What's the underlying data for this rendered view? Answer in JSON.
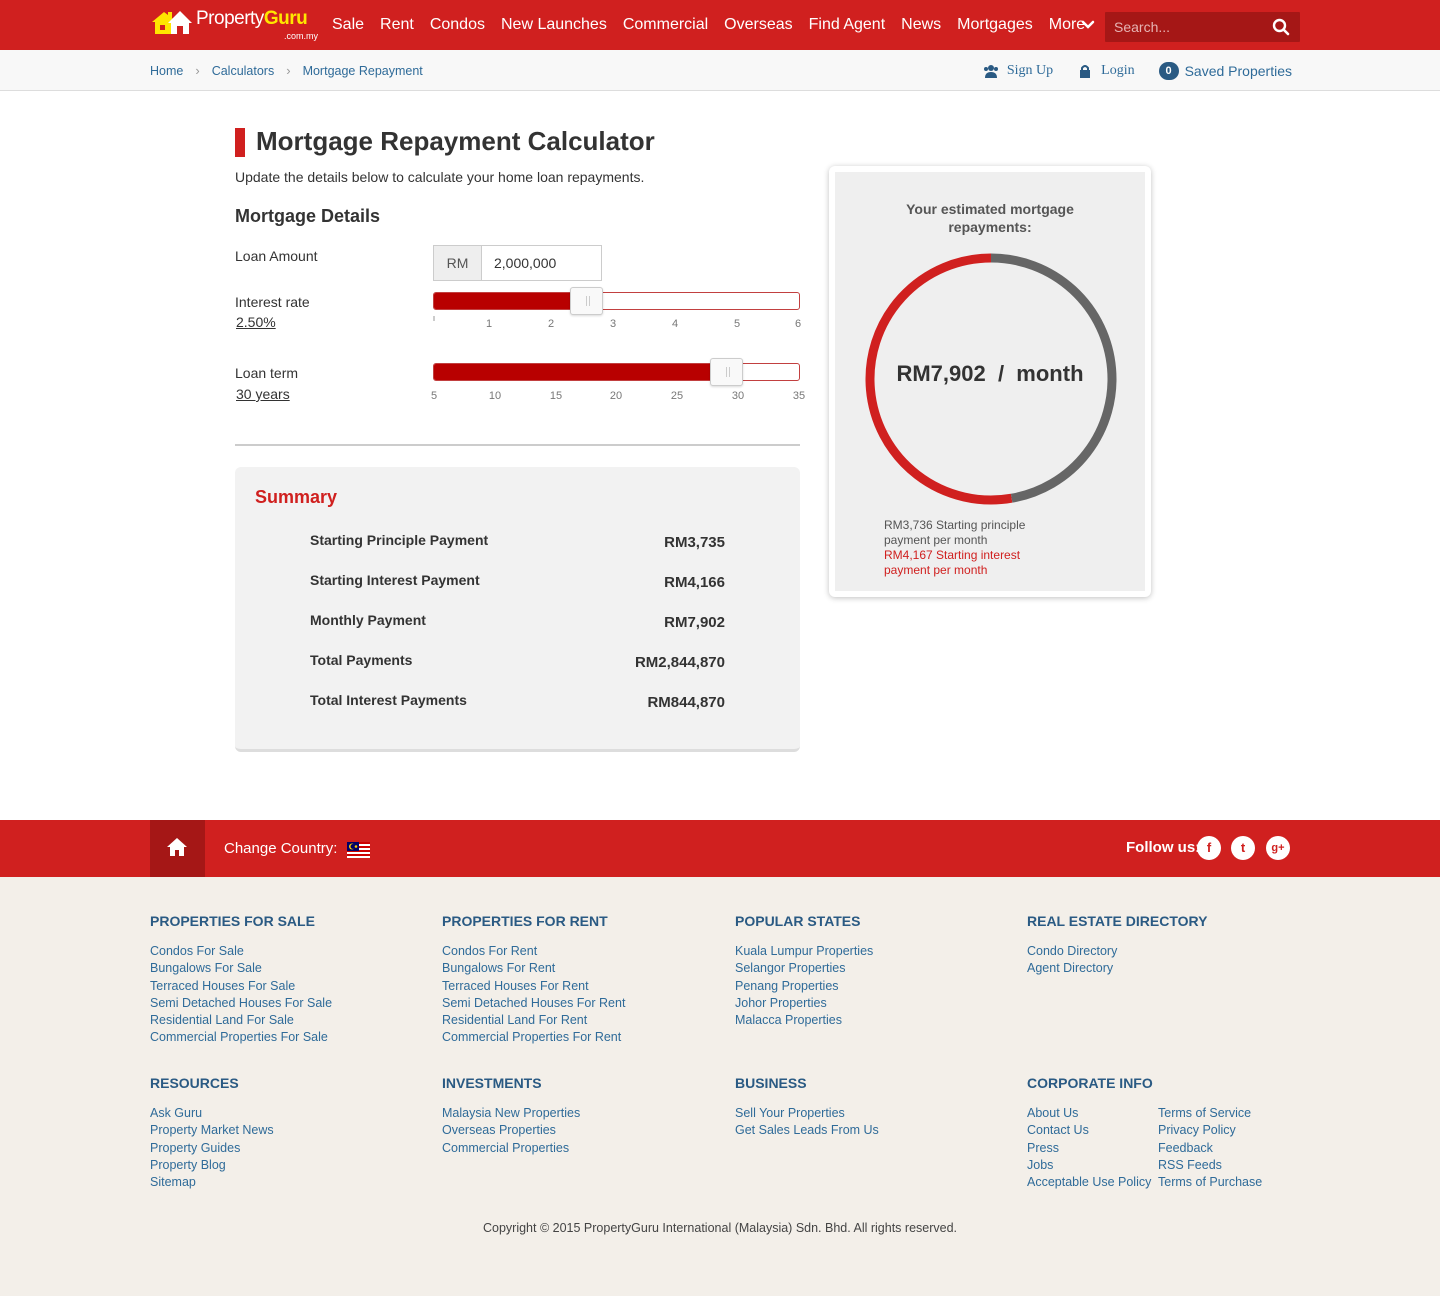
{
  "header": {
    "logo_main": "Property",
    "logo_accent": "Guru",
    "logo_domain": ".com.my",
    "nav": [
      "Sale",
      "Rent",
      "Condos",
      "New Launches",
      "Commercial",
      "Overseas",
      "Find Agent",
      "News",
      "Mortgages",
      "More"
    ],
    "search_placeholder": "Search..."
  },
  "subbar": {
    "breadcrumbs": [
      "Home",
      "Calculators",
      "Mortgage Repayment"
    ],
    "signup": "Sign Up",
    "login": "Login",
    "saved_count": "0",
    "saved_label": "Saved Properties"
  },
  "main": {
    "title": "Mortgage Repayment Calculator",
    "subtitle": "Update the details below to calculate your home loan repayments.",
    "section": "Mortgage Details",
    "loan_amount_label": "Loan Amount",
    "currency_prefix": "RM",
    "loan_amount_value": "2,000,000",
    "interest_label": "Interest rate",
    "interest_value": "2.50%",
    "interest_fraction": 0.41,
    "interest_ticks": [
      "",
      "1",
      "2",
      "3",
      "4",
      "5",
      "6"
    ],
    "term_label": "Loan term",
    "term_value": "30 years",
    "term_fraction": 0.83,
    "term_ticks": [
      "5",
      "10",
      "15",
      "20",
      "25",
      "30",
      "35"
    ]
  },
  "summary": {
    "title": "Summary",
    "rows": [
      {
        "label": "Starting Principle Payment",
        "value": "RM3,735"
      },
      {
        "label": "Starting Interest Payment",
        "value": "RM4,166"
      },
      {
        "label": "Monthly Payment",
        "value": "RM7,902"
      },
      {
        "label": "Total Payments",
        "value": "RM2,844,870"
      },
      {
        "label": "Total Interest Payments",
        "value": "RM844,870"
      }
    ]
  },
  "result": {
    "title": "Your estimated mortgage repayments:",
    "monthly": "RM7,902  /  month",
    "principal_text": "RM3,736 Starting principle payment per month",
    "interest_text": "RM4,167 Starting interest payment per month",
    "principal_value": 3736,
    "interest_value": 4167,
    "principal_color": "#666666",
    "interest_color": "#d0201f"
  },
  "footer": {
    "change_country": "Change Country:",
    "follow": "Follow us:",
    "social": [
      "facebook-icon",
      "twitter-icon",
      "google-plus-icon"
    ],
    "columns_row1": [
      {
        "title": "PROPERTIES FOR SALE",
        "links": [
          "Condos For Sale",
          "Bungalows For Sale",
          "Terraced Houses For Sale",
          "Semi Detached Houses For Sale",
          "Residential Land For Sale",
          "Commercial Properties For Sale"
        ]
      },
      {
        "title": "PROPERTIES FOR RENT",
        "links": [
          "Condos For Rent",
          "Bungalows For Rent",
          "Terraced Houses For Rent",
          "Semi Detached Houses For Rent",
          "Residential Land For Rent",
          "Commercial Properties For Rent"
        ]
      },
      {
        "title": "POPULAR STATES",
        "links": [
          "Kuala Lumpur Properties",
          "Selangor Properties",
          "Penang Properties",
          "Johor Properties",
          "Malacca Properties"
        ]
      },
      {
        "title": "REAL ESTATE DIRECTORY",
        "links": [
          "Condo Directory",
          "Agent Directory"
        ]
      }
    ],
    "columns_row2": [
      {
        "title": "RESOURCES",
        "links": [
          "Ask Guru",
          "Property Market News",
          "Property Guides",
          "Property Blog",
          "Sitemap"
        ]
      },
      {
        "title": "INVESTMENTS",
        "links": [
          "Malaysia New Properties",
          "Overseas Properties",
          "Commercial Properties"
        ]
      },
      {
        "title": "BUSINESS",
        "links": [
          "Sell Your Properties",
          "Get Sales Leads From Us"
        ]
      },
      {
        "title": "CORPORATE INFO",
        "links": [
          "About Us",
          "Contact Us",
          "Press",
          "Jobs",
          "Acceptable Use Policy"
        ],
        "links2": [
          "Terms of Service",
          "Privacy Policy",
          "Feedback",
          "RSS Feeds",
          "Terms of Purchase"
        ]
      }
    ],
    "copyright": "Copyright © 2015 PropertyGuru International (Malaysia) Sdn. Bhd. All rights reserved."
  }
}
